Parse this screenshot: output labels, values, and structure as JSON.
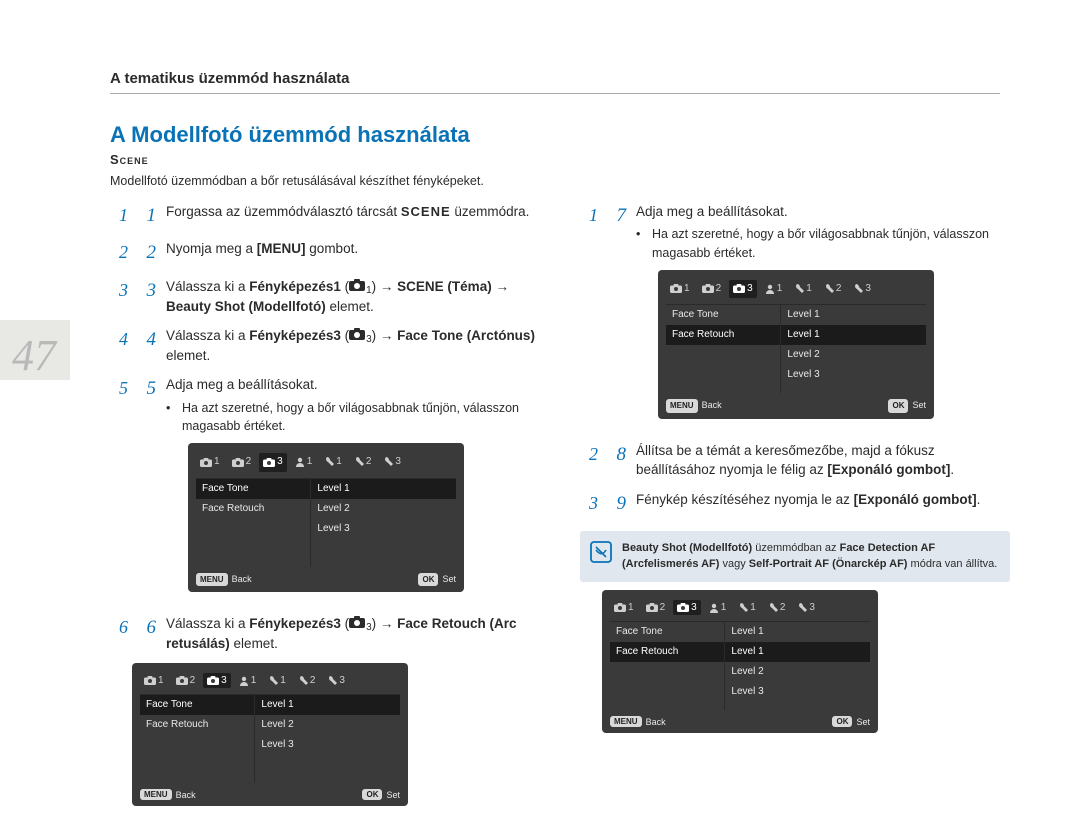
{
  "header": "A tematikus üzemmód használata",
  "pageNumber": "47",
  "title": "A Modellfotó üzemmód használata",
  "modeWord": "Scene",
  "intro": "Modellfotó üzemmódban a bőr retusálásával készíthet fényképeket.",
  "steps_left": [
    {
      "num": "1",
      "html": "Forgassa az üzemmódválasztó tárcsát <b class='modeword'>SCENE</b> üzemmódra."
    },
    {
      "num": "2",
      "html": "Nyomja meg a <b>[MENU]</b> gombot."
    },
    {
      "num": "3",
      "html": "Válassza ki a <b>Fényképezés1</b> ({{CAM1}}) → <b>SCENE (Téma) → Beauty Shot (Modellfotó)</b> elemet."
    },
    {
      "num": "4",
      "html": "Válassza ki a <b>Fényképezés3</b> ({{CAM3}}) → <b>Face Tone (Arctónus)</b> elemet."
    },
    {
      "num": "5",
      "html": "Adja meg a beállításokat.",
      "bullet": "Ha azt szeretné, hogy a bőr világosabbnak tűnjön, válasszon magasabb értéket."
    },
    {
      "num": "6",
      "html": "Válassza ki a <b>Fénykepezés3</b> ({{CAM3}}) → <b>Face Retouch (Arc retusálás)</b> elemet."
    }
  ],
  "steps_right": [
    {
      "num": "7",
      "html": "Adja meg a beállításokat.",
      "bullet": "Ha azt szeretné, hogy a bőr világosabbnak tűnjön, válasszon magasabb értéket."
    },
    {
      "num": "8",
      "html": "Állítsa be a témát a keresőmezőbe, majd a fókusz beállításához nyomja le félig az <b>[Exponáló gombot]</b>."
    },
    {
      "num": "9",
      "html": "Fénykép készítéséhez nyomja le az <b>[Exponáló gombot]</b>."
    }
  ],
  "lcd1": {
    "tabs": [
      "1",
      "2",
      "3",
      "1",
      "1",
      "2",
      "3"
    ],
    "selectedTab": 2,
    "left": [
      "Face Tone",
      "Face Retouch"
    ],
    "leftSel": 0,
    "right": [
      "Level 1",
      "Level 2",
      "Level 3"
    ],
    "rightSel": 0,
    "footBackBtn": "MENU",
    "footBack": "Back",
    "footSetBtn": "OK",
    "footSet": "Set"
  },
  "lcd2": {
    "tabs": [
      "1",
      "2",
      "3",
      "1",
      "1",
      "2",
      "3"
    ],
    "selectedTab": 2,
    "left": [
      "Face Tone",
      "Face Retouch"
    ],
    "leftSel": 1,
    "right": [
      "Level 1",
      "Level 1",
      "Level 2",
      "Level 3"
    ],
    "rightSel": 1,
    "footBackBtn": "MENU",
    "footBack": "Back",
    "footSetBtn": "OK",
    "footSet": "Set"
  },
  "note": "<b>Beauty Shot (Modellfotó)</b> üzemmódban az <b>Face Detection AF (Arcfelismerés AF)</b> vagy <b>Self-Portrait AF (Önarckép AF)</b> módra van állítva."
}
